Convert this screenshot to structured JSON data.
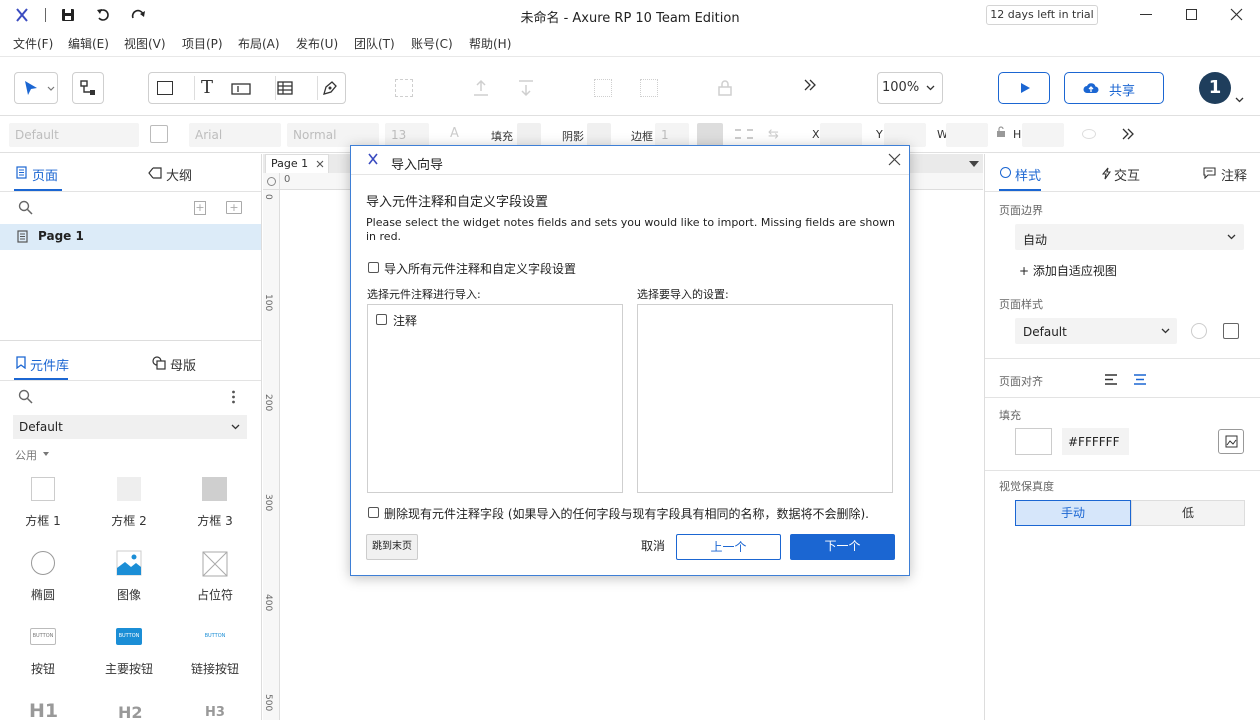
{
  "window": {
    "title": "未命名 - Axure RP 10 Team Edition",
    "trial_badge": "12 days left in trial"
  },
  "menu": [
    "文件(F)",
    "编辑(E)",
    "视图(V)",
    "项目(P)",
    "布局(A)",
    "发布(U)",
    "团队(T)",
    "账号(C)",
    "帮助(H)"
  ],
  "toolbar": {
    "zoom": "100%",
    "share_label": "共享",
    "avatar": "1"
  },
  "stylebar": {
    "style_value": "Default",
    "font_value": "Arial",
    "weight_value": "Normal",
    "size_value": "13",
    "fill_label": "填充",
    "shadow_label": "阴影",
    "border_label": "边框",
    "border_value": "1",
    "x_label": "X",
    "y_label": "Y",
    "w_label": "W",
    "h_label": "H"
  },
  "left_panel": {
    "tab_pages": "页面",
    "tab_outline": "大纲",
    "pages": [
      "Page 1"
    ],
    "tab_library": "元件库",
    "tab_masters": "母版",
    "library_select": "Default",
    "category": "公用",
    "widgets": [
      {
        "label": "方框 1"
      },
      {
        "label": "方框 2"
      },
      {
        "label": "方框 3"
      },
      {
        "label": "椭圆"
      },
      {
        "label": "图像"
      },
      {
        "label": "占位符"
      },
      {
        "label": "按钮"
      },
      {
        "label": "主要按钮"
      },
      {
        "label": "链接按钮"
      }
    ],
    "button_text": "BUTTON",
    "headings": [
      "H1",
      "H2",
      "H3"
    ]
  },
  "canvas": {
    "tab_label": "Page 1",
    "ruler_h_zero": "0",
    "ruler_v_labels": [
      "0",
      "100",
      "200",
      "300",
      "400",
      "500"
    ]
  },
  "right_panel": {
    "tab_style": "样式",
    "tab_interact": "交互",
    "tab_notes": "注释",
    "page_margin_label": "页面边界",
    "page_margin_value": "自动",
    "add_adaptive": "+ 添加自适应视图",
    "page_style_label": "页面样式",
    "page_style_value": "Default",
    "page_align_label": "页面对齐",
    "fill_label": "填充",
    "fill_value": "#FFFFFF",
    "fidelity_label": "视觉保真度",
    "fidelity_manual": "手动",
    "fidelity_low": "低",
    "accent": "#1b66d2"
  },
  "dialog": {
    "title": "导入向导",
    "heading": "导入元件注释和自定义字段设置",
    "description": "Please select the widget notes fields and sets you would like to import. Missing fields are shown in red.",
    "import_all_label": "导入所有元件注释和自定义字段设置",
    "select_notes_label": "选择元件注释进行导入:",
    "select_settings_label": "选择要导入的设置:",
    "notes_item": "注释",
    "delete_existing_label": "删除现有元件注释字段 (如果导入的任何字段与现有字段具有相同的名称，数据将不会删除).",
    "skip_button": "跳到末页",
    "cancel_button": "取消",
    "prev_button": "上一个",
    "next_button": "下一个"
  }
}
